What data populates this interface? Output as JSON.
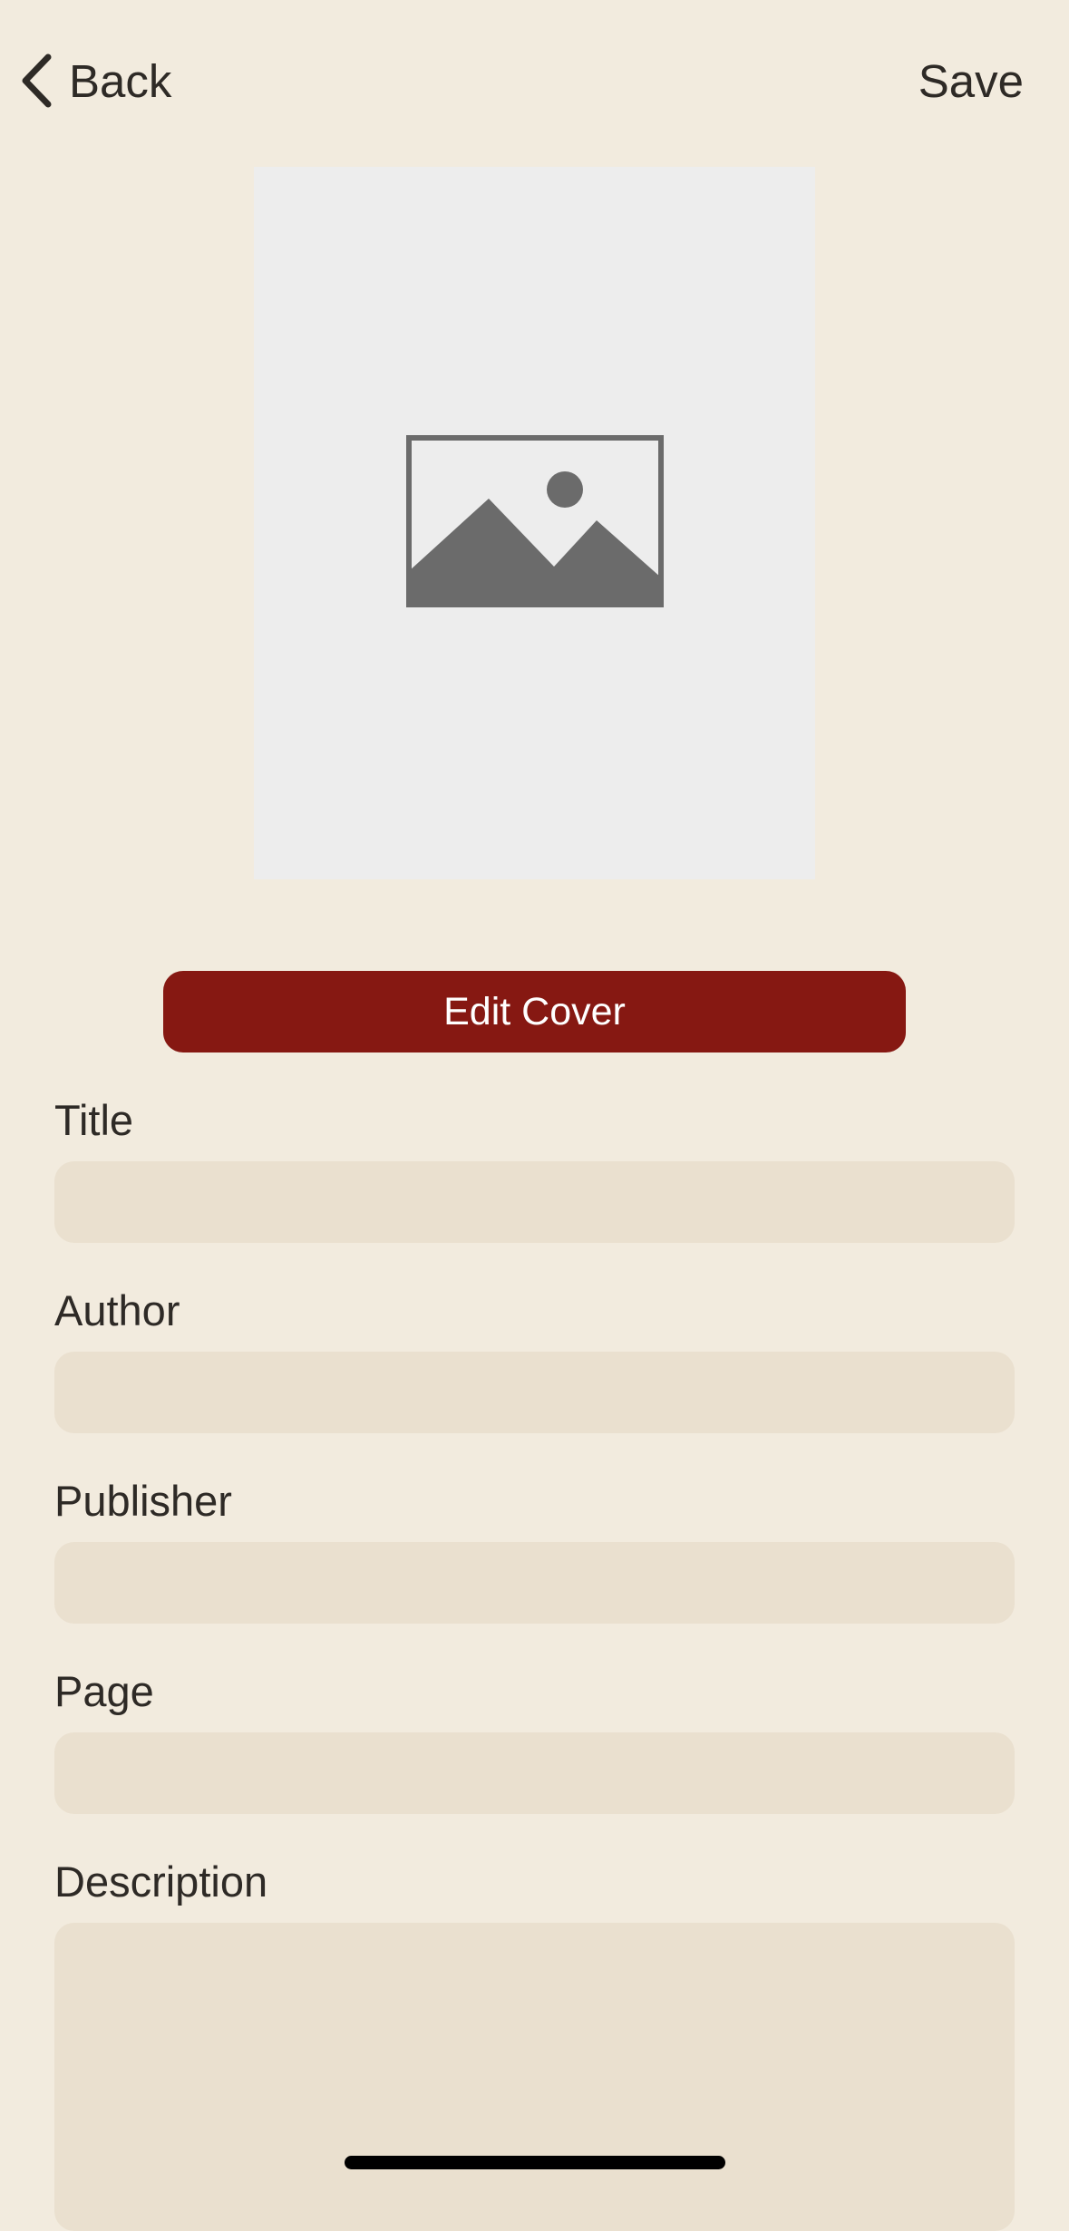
{
  "nav": {
    "back_label": "Back",
    "save_label": "Save"
  },
  "cover": {
    "placeholder_icon": "image-placeholder-icon",
    "edit_button_label": "Edit Cover"
  },
  "form": {
    "title": {
      "label": "Title",
      "value": ""
    },
    "author": {
      "label": "Author",
      "value": ""
    },
    "publisher": {
      "label": "Publisher",
      "value": ""
    },
    "page": {
      "label": "Page",
      "value": ""
    },
    "description": {
      "label": "Description",
      "value": ""
    }
  },
  "colors": {
    "background": "#f2ebde",
    "accent": "#861812",
    "field_background": "#eae0cf",
    "cover_placeholder": "#ededed"
  }
}
